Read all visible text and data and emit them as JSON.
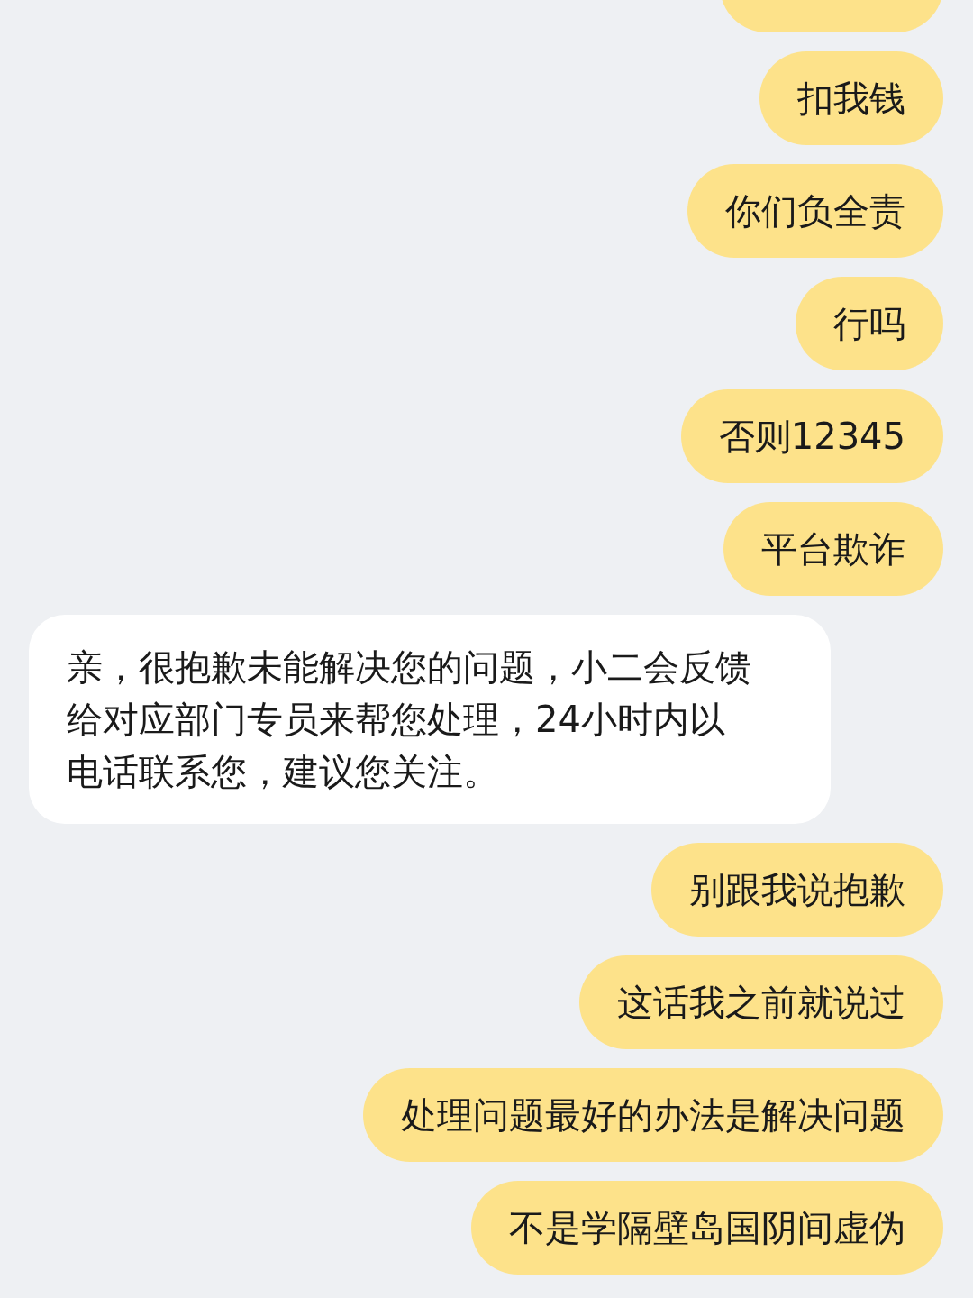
{
  "messages": [
    {
      "kind": "sent",
      "text": "扣我钱"
    },
    {
      "kind": "sent",
      "text": "你们负全责"
    },
    {
      "kind": "sent",
      "text": "行吗"
    },
    {
      "kind": "sent",
      "text": "否则12345"
    },
    {
      "kind": "sent",
      "text": "平台欺诈"
    },
    {
      "kind": "received",
      "text": "亲，很抱歉未能解决您的问题，小二会反馈给对应部门专员来帮您处理，24小时内以电话联系您，建议您关注。"
    },
    {
      "kind": "sent",
      "text": "别跟我说抱歉"
    },
    {
      "kind": "sent",
      "text": "这话我之前就说过"
    },
    {
      "kind": "sent",
      "text": "处理问题最好的办法是解决问题"
    },
    {
      "kind": "sent",
      "text": "不是学隔壁岛国阴间虚伪"
    }
  ]
}
